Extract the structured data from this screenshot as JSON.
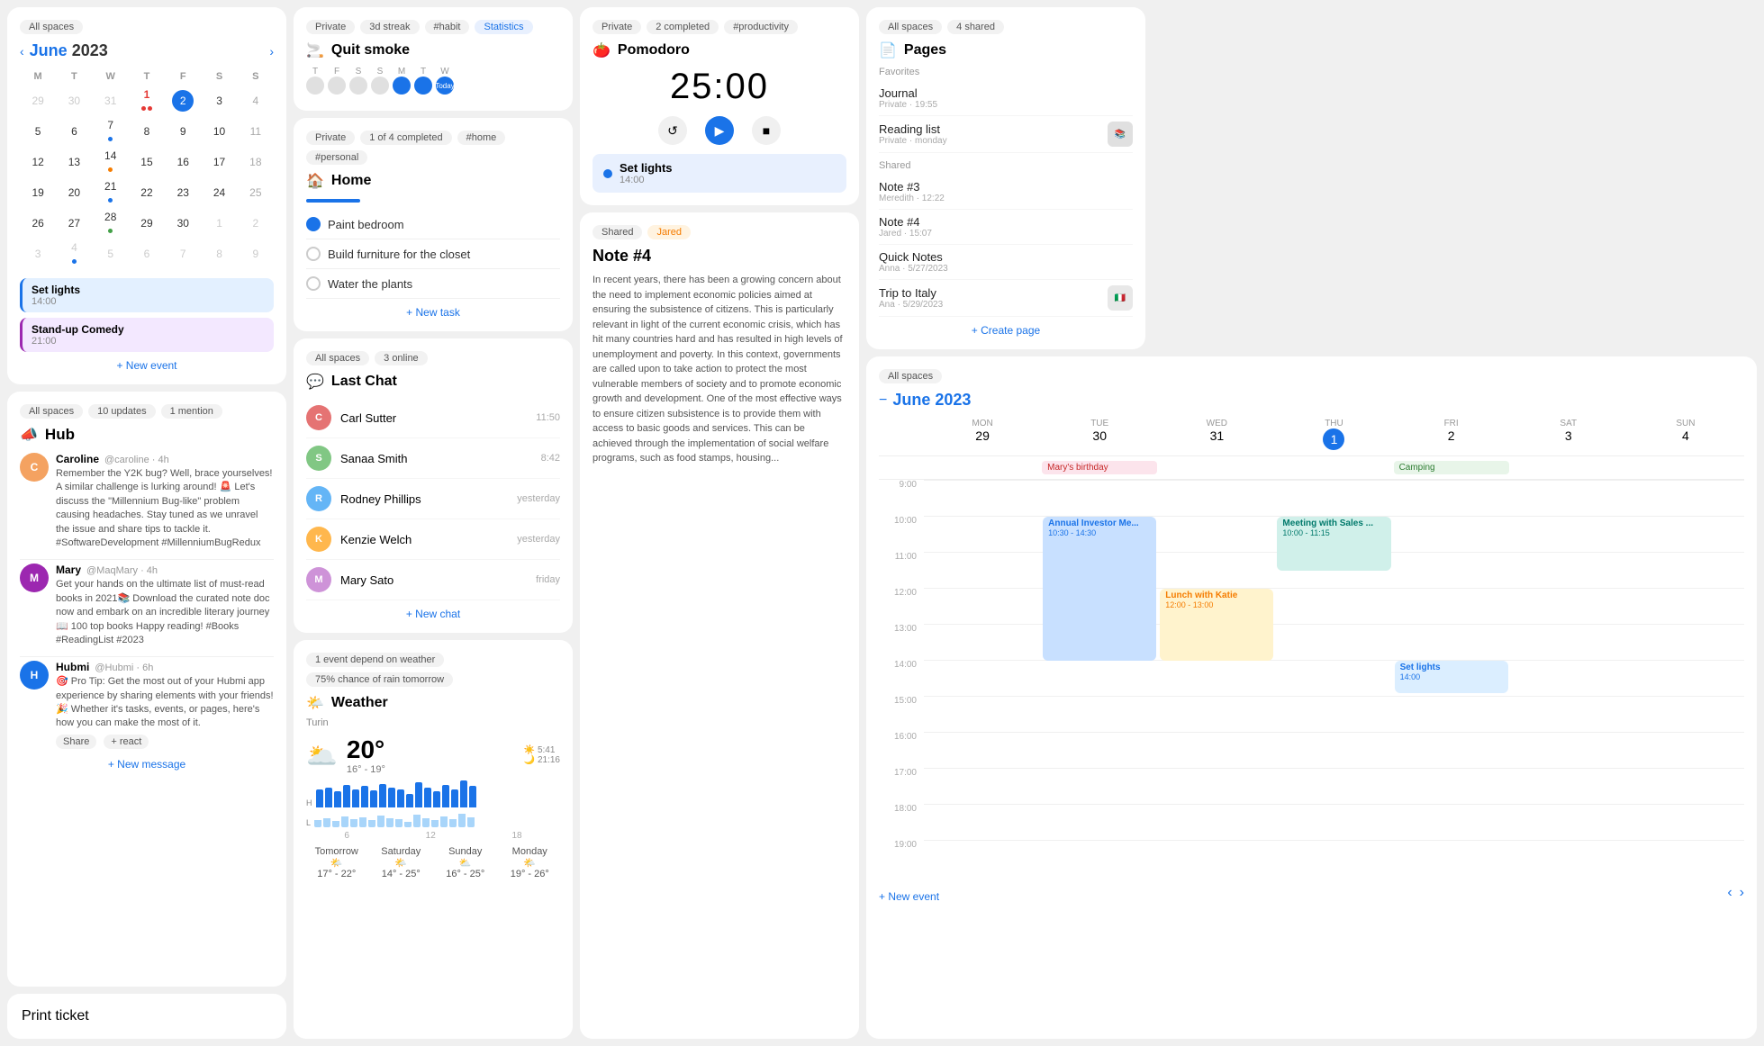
{
  "col1": {
    "allSpaces": "All spaces",
    "calTitle1": "June",
    "calYear1": "2023",
    "calDays": [
      "M",
      "T",
      "W",
      "T",
      "F",
      "S",
      "S"
    ],
    "calWeeks": [
      [
        "29",
        "30",
        "31",
        "1",
        "2",
        "3",
        "4"
      ],
      [
        "5",
        "6",
        "7",
        "8",
        "9",
        "10",
        "11"
      ],
      [
        "12",
        "13",
        "14",
        "15",
        "16",
        "17",
        "18"
      ],
      [
        "19",
        "20",
        "21",
        "22",
        "23",
        "24",
        "25"
      ],
      [
        "26",
        "27",
        "28",
        "29",
        "30",
        "1",
        "2"
      ],
      [
        "3",
        "4",
        "5",
        "6",
        "7",
        "8",
        "9"
      ]
    ],
    "event1_title": "Set lights",
    "event1_time": "14:00",
    "event2_title": "Stand-up Comedy",
    "event2_time": "21:00",
    "newEvent": "+ New event",
    "hubBadge": "All spaces",
    "hubUpdates": "10 updates",
    "hubMention": "1 mention",
    "hubIcon": "📣",
    "hubTitle": "Hub",
    "msg1_name": "Caroline",
    "msg1_handle": "@caroline · 4h",
    "msg1_text": "Remember the Y2K bug? Well, brace yourselves! A similar challenge is lurking around! 🚨 Let's discuss the \"Millennium Bug-like\" problem causing headaches. Stay tuned as we unravel the issue and share tips to tackle it. #SoftwareDevelopment #MillenniumBugRedux",
    "msg2_name": "Mary",
    "msg2_handle": "@MaqMary · 4h",
    "msg2_text": "Get your hands on the ultimate list of must-read books in 2021📚\nDownload the curated note doc now and embark on an incredible literary journey\n📖 100 top books\nHappy reading!\n#Books #ReadingList #2023",
    "msg3_name": "Hubmi",
    "msg3_handle": "@Hubmi · 6h",
    "msg3_text": "🎯 Pro Tip: Get the most out of your Hubmi app experience by sharing elements with your friends! 🎉   Whether it's tasks, events, or pages, here's how you can make the most of it.",
    "msg3_actions": [
      "Share",
      "+ react"
    ],
    "newMessage": "+ New message",
    "printTicket": "Print ticket"
  },
  "col2": {
    "privateBadge": "Private",
    "streakBadge": "3d streak",
    "habitBadge": "#habit",
    "statsBadge": "Statistics",
    "quitSmoke_icon": "🚬",
    "quitSmoke_title": "Quit smoke",
    "streak_days": [
      "T",
      "F",
      "S",
      "S",
      "M",
      "T",
      "W"
    ],
    "streak_today": "Today",
    "home_private": "Private",
    "home_completed": "1 of 4 completed",
    "home_home": "#home",
    "home_personal": "#personal",
    "home_icon": "🏠",
    "home_title": "Home",
    "home_tasks": [
      {
        "label": "Paint bedroom",
        "done": true
      },
      {
        "label": "Build furniture for the closet",
        "done": false
      },
      {
        "label": "Water the plants",
        "done": false
      }
    ],
    "home_newTask": "+ New task",
    "chat_allSpaces": "All spaces",
    "chat_online": "3 online",
    "chat_icon": "💬",
    "chat_title": "Last Chat",
    "chat_people": [
      {
        "name": "Carl Sutter",
        "time": "11:50"
      },
      {
        "name": "Sanaa Smith",
        "time": "8:42"
      },
      {
        "name": "Rodney Phillips",
        "time": "yesterday"
      },
      {
        "name": "Kenzie Welch",
        "time": "yesterday"
      },
      {
        "name": "Mary Sato",
        "time": "friday"
      }
    ],
    "chat_new": "+ New chat",
    "weather_badge1": "1 event depend on weather",
    "weather_badge2": "75% chance of rain tomorrow",
    "weather_icon": "🌤️",
    "weather_title": "Weather",
    "weather_location": "Turin",
    "weather_icon2": "🌥️",
    "weather_temp": "20°",
    "weather_hi": "16° - 19°",
    "weather_sun": "5:41",
    "weather_moon": "21:16",
    "weather_hLabel": "H",
    "weather_lLabel": "L",
    "weather_days": [
      {
        "label": "Tomorrow",
        "icon": "🌤️",
        "range": "17° - 22°"
      },
      {
        "label": "Saturday",
        "icon": "🌤️",
        "range": "14° - 25°"
      },
      {
        "label": "Sunday",
        "icon": "⛅",
        "range": "16° - 25°"
      },
      {
        "label": "Monday",
        "icon": "🌤️",
        "range": "19° - 26°"
      }
    ]
  },
  "col3": {
    "pomo_private": "Private",
    "pomo_completed": "2 completed",
    "pomo_productivity": "#productivity",
    "pomo_icon": "🍅",
    "pomo_title": "Pomodoro",
    "pomo_time": "25:00",
    "setLights_title": "Set lights",
    "setLights_time": "14:00",
    "note_shared": "Shared",
    "note_jared": "Jared",
    "note_title": "Note #4",
    "note_text": "In recent years, there has been a growing concern about the need to implement economic policies aimed at ensuring the subsistence of citizens. This is particularly relevant in light of the current economic crisis, which has hit many countries hard and has resulted in high levels of unemployment and poverty. In this context, governments are called upon to take action to protect the most vulnerable members of society and to promote economic growth and development.\nOne of the most effective ways to ensure citizen subsistence is to provide them with access to basic goods and services. This can be achieved through the implementation of social welfare programs, such as food stamps, housing..."
  },
  "col4": {
    "pages_allSpaces": "All spaces",
    "pages_shared": "4 shared",
    "pages_icon": "📄",
    "pages_title": "Pages",
    "favorites_label": "Favorites",
    "journal_name": "Journal",
    "journal_meta": "Private · 19:55",
    "readinglist_name": "Reading list",
    "readinglist_meta": "Private · monday",
    "shared_label": "Shared",
    "note3_name": "Note #3",
    "note3_meta": "Meredith · 12:22",
    "note4_name": "Note #4",
    "note4_meta": "Jared · 15:07",
    "quicknotes_name": "Quick Notes",
    "quicknotes_meta": "Anna · 5/27/2023",
    "tripitaly_name": "Trip to Italy",
    "tripitaly_meta": "Ana · 5/29/2023",
    "createPage": "+ Create page",
    "week_allSpaces": "All spaces",
    "week_calTitle": "June",
    "week_calYear": "2023",
    "week_days": [
      {
        "day": "MON",
        "num": "29"
      },
      {
        "day": "TUE",
        "num": "30"
      },
      {
        "day": "WED",
        "num": "31"
      },
      {
        "day": "THU",
        "num": "1"
      },
      {
        "day": "FRI",
        "num": "2"
      },
      {
        "day": "SAT",
        "num": "3"
      },
      {
        "day": "SUN",
        "num": "4"
      }
    ],
    "week_allday": [
      {
        "col": 2,
        "label": "Mary's birthday",
        "color": "pink"
      },
      {
        "col": 5,
        "label": "Camping",
        "color": "green"
      }
    ],
    "week_times": [
      "9:00",
      "10:00",
      "11:00",
      "12:00",
      "13:00",
      "14:00",
      "15:00",
      "16:00",
      "17:00",
      "18:00",
      "19:00"
    ],
    "week_events": [
      {
        "title": "Annual Investor Me...",
        "sub": "10:30 - 14:30",
        "col": 2,
        "startRow": 2,
        "span": 4,
        "color": "blue"
      },
      {
        "title": "Meeting with Sales ...",
        "sub": "10:00 - 11:15",
        "col": 4,
        "startRow": 2,
        "span": 2,
        "color": "teal"
      },
      {
        "title": "Lunch with Katie",
        "sub": "12:00 - 13:00",
        "col": 3,
        "startRow": 4,
        "span": 2,
        "color": "orange"
      },
      {
        "title": "Set lights",
        "sub": "14:00",
        "col": 5,
        "startRow": 6,
        "span": 1,
        "color": "lightblue"
      }
    ],
    "newEvent": "+ New event"
  }
}
